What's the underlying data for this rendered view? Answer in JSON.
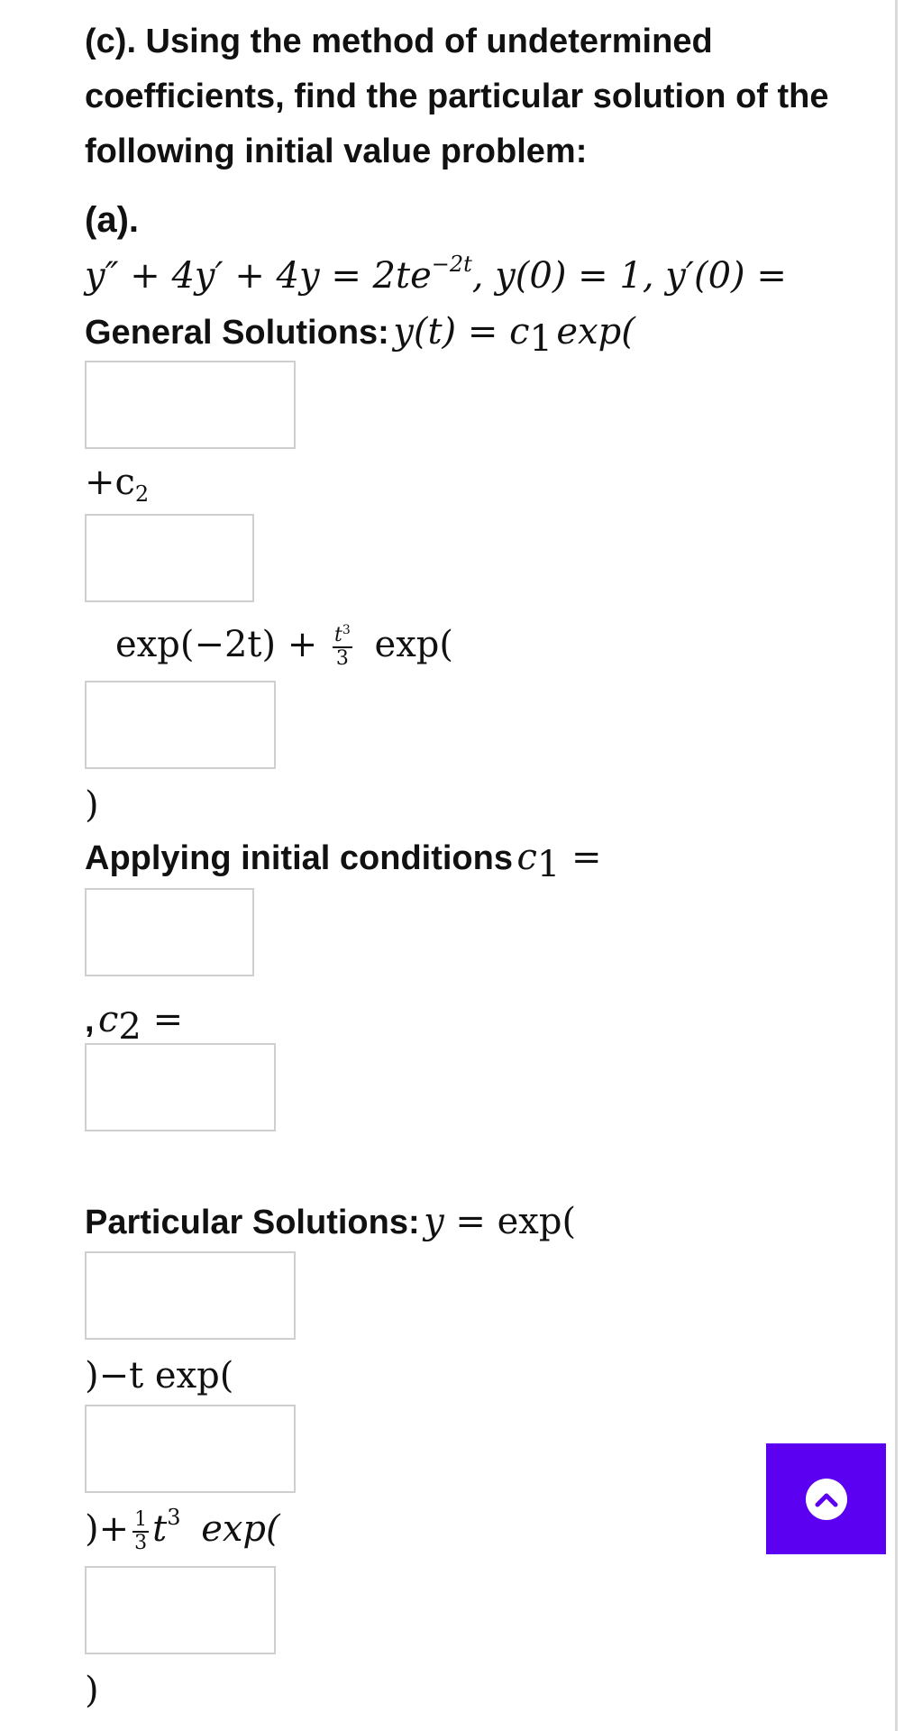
{
  "question": {
    "heading": "(c). Using the method of undetermined coefficients, find the particular solution of the following initial value problem:",
    "part_label": "(a).",
    "equation": {
      "lhs": "y″ + 4y′ + 4y = 2te",
      "exponent": "−2t",
      "conditions": ",  y(0) = 1,  y′(0) ="
    }
  },
  "general": {
    "label": "General Solutions:",
    "expr": "y(t) = c",
    "c_sub": "1",
    "exp_open": "exp(",
    "plus_c": "+c",
    "c2_sub": "2",
    "exp_minus_2t": "exp(−2t) +",
    "t_cubed": "t",
    "cube": "3",
    "three": "3",
    "exp_open2": "exp(",
    "close_paren": ")"
  },
  "initial": {
    "label": "Applying initial conditions",
    "c1": "c",
    "c1_sub": "1",
    "equals": " =",
    "comma": ",",
    "c2": "c",
    "c2_sub": "2",
    "equals2": " ="
  },
  "particular": {
    "label": "Particular Solutions:",
    "expr": "y =  ",
    "exp_open": "exp(",
    "line2": ")−t  exp(",
    "line3_open": ")+",
    "frac_num": "1",
    "frac_den": "3",
    "t": "t",
    "cube": "3",
    "exp_open3": "exp(",
    "close": ")"
  },
  "inputs": [
    {
      "value": ""
    },
    {
      "value": ""
    },
    {
      "value": ""
    },
    {
      "value": ""
    },
    {
      "value": ""
    },
    {
      "value": ""
    },
    {
      "value": ""
    },
    {
      "value": ""
    }
  ],
  "colors": {
    "accent": "#5b00f0",
    "box_border": "#cfcfcf"
  },
  "scroll_button": {
    "icon": "chevron-up-icon"
  }
}
